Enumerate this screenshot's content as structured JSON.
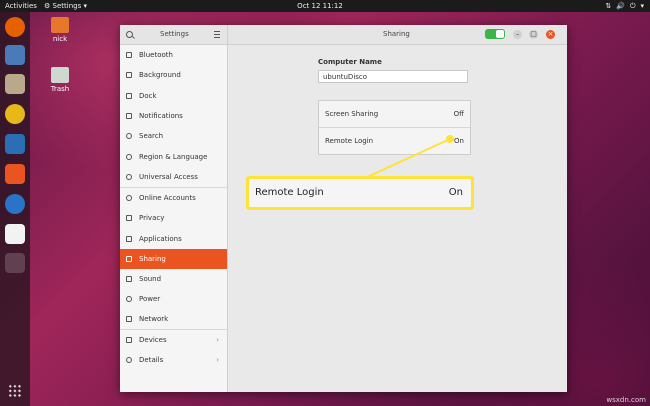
{
  "topbar": {
    "activities": "Activities",
    "app_menu": "Settings",
    "clock": "Oct 12  11:12"
  },
  "desktop_icons": [
    {
      "label": "nick"
    },
    {
      "label": "Trash"
    }
  ],
  "window": {
    "sidebar_title": "Settings",
    "panel_title": "Sharing",
    "sharing_toggle": "on",
    "close_glyph": "×"
  },
  "sidebar": {
    "items": [
      {
        "label": "Bluetooth",
        "icon": "bluetooth-icon"
      },
      {
        "label": "Background",
        "icon": "background-icon"
      },
      {
        "label": "Dock",
        "icon": "dock-icon"
      },
      {
        "label": "Notifications",
        "icon": "bell-icon"
      },
      {
        "label": "Search",
        "icon": "search-icon"
      },
      {
        "label": "Region & Language",
        "icon": "globe-icon"
      },
      {
        "label": "Universal Access",
        "icon": "accessibility-icon"
      },
      {
        "label": "Online Accounts",
        "icon": "cloud-icon"
      },
      {
        "label": "Privacy",
        "icon": "hand-icon"
      },
      {
        "label": "Applications",
        "icon": "applications-icon"
      },
      {
        "label": "Sharing",
        "icon": "share-icon",
        "selected": true
      },
      {
        "label": "Sound",
        "icon": "music-note-icon"
      },
      {
        "label": "Power",
        "icon": "power-icon"
      },
      {
        "label": "Network",
        "icon": "network-icon"
      },
      {
        "label": "Devices",
        "icon": "devices-icon",
        "chevron": "›"
      },
      {
        "label": "Details",
        "icon": "info-icon",
        "chevron": "›"
      }
    ]
  },
  "sharing": {
    "computer_name_label": "Computer Name",
    "computer_name_value": "ubuntuDisco",
    "screen_sharing_label": "Screen Sharing",
    "screen_sharing_state": "Off",
    "remote_login_label": "Remote Login",
    "remote_login_state": "On"
  },
  "callout": {
    "label": "Remote Login",
    "state": "On"
  },
  "watermark": "wsxdn.com",
  "colors": {
    "accent": "#e95420",
    "highlight": "#fde33a",
    "toggle_on": "#3bb54a"
  }
}
